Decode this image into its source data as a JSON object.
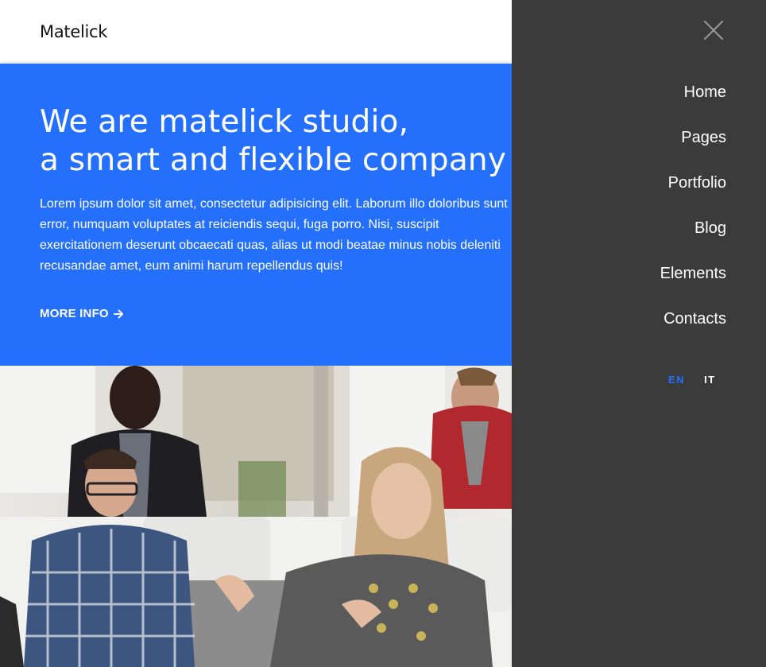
{
  "brand": {
    "logo_text": "Matelick"
  },
  "hero": {
    "title_line1": "We are matelick studio,",
    "title_line2": "a smart and flexible company",
    "body": "Lorem ipsum dolor sit amet, consectetur adipisicing elit. Laborum illo doloribus sunt error, numquam voluptates at reiciendis sequi, fuga porro. Nisi, suscipit exercitationem deserunt obcaecati quas, alias ut modi beatae minus nobis deleniti recusandae amet, eum animi harum repellendus quis!",
    "cta_label": "MORE INFO",
    "cta_icon": "arrow-right-icon",
    "background_color": "#2470fd"
  },
  "menu": {
    "close_icon": "close-icon",
    "items": [
      {
        "label": "Home"
      },
      {
        "label": "Pages"
      },
      {
        "label": "Portfolio"
      },
      {
        "label": "Blog"
      },
      {
        "label": "Elements"
      },
      {
        "label": "Contacts"
      }
    ],
    "languages": [
      {
        "code": "EN",
        "active": true,
        "color": "#2470fd"
      },
      {
        "code": "IT",
        "active": false,
        "color": "#ffffff"
      }
    ],
    "background_color": "#3b3b3b"
  },
  "photo": {
    "description_icon": "team-photo"
  }
}
